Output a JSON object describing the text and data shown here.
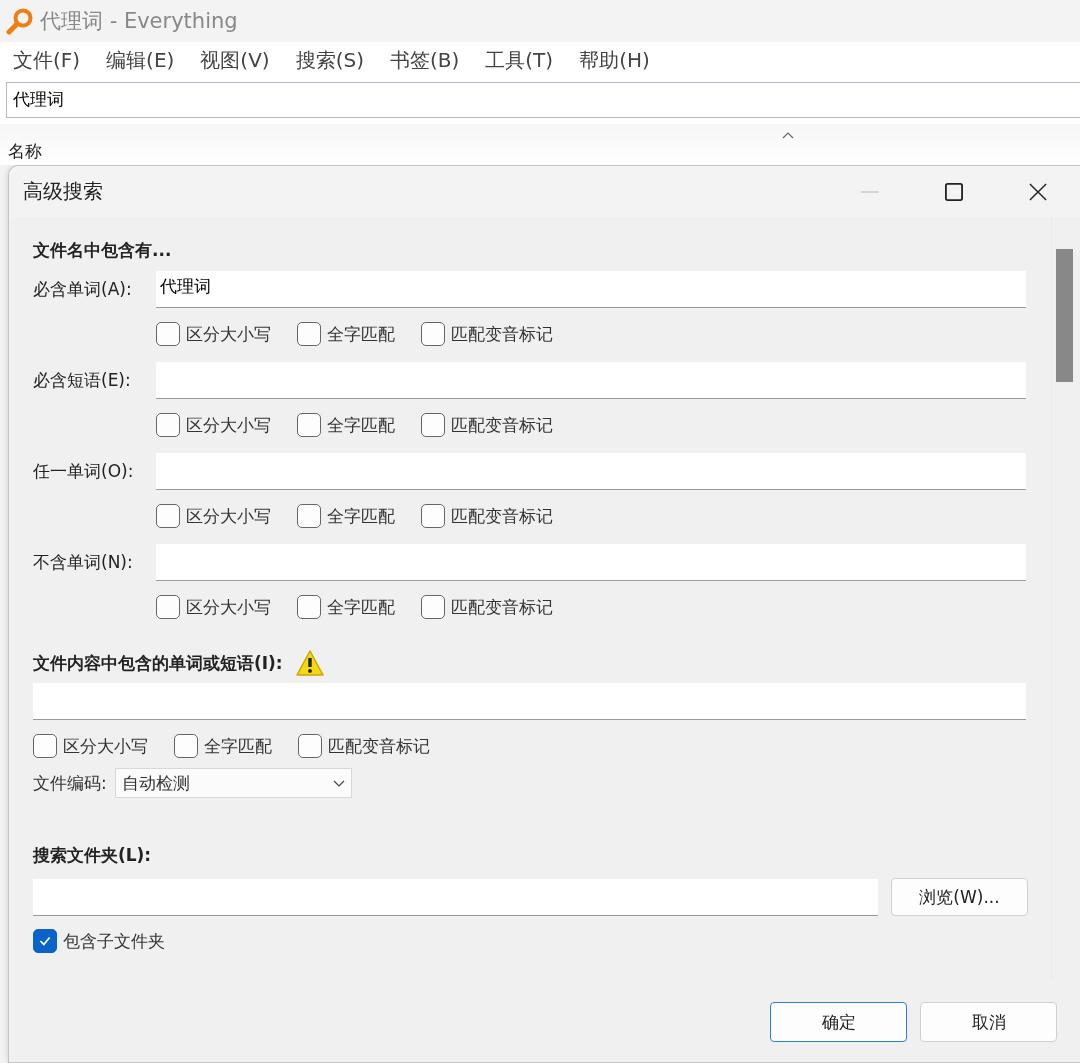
{
  "window": {
    "title": "代理词 - Everything"
  },
  "menu": [
    "文件(F)",
    "编辑(E)",
    "视图(V)",
    "搜索(S)",
    "书签(B)",
    "工具(T)",
    "帮助(H)"
  ],
  "search": {
    "value": "代理词"
  },
  "columns": [
    {
      "label": "名称"
    }
  ],
  "dialog": {
    "title": "高级搜索",
    "minimize_disabled": true,
    "name_section": {
      "heading": "文件名中包含有...",
      "rows": [
        {
          "label": "必含单词(A):",
          "value": "代理词",
          "options": [
            {
              "label": "区分大小写",
              "checked": false
            },
            {
              "label": "全字匹配",
              "checked": false
            },
            {
              "label": "匹配变音标记",
              "checked": false
            }
          ]
        },
        {
          "label": "必含短语(E):",
          "options": [
            {
              "label": "区分大小写",
              "checked": false
            },
            {
              "label": "全字匹配",
              "checked": false
            },
            {
              "label": "匹配变音标记",
              "checked": false
            }
          ]
        },
        {
          "label": "任一单词(O):",
          "options": [
            {
              "label": "区分大小写",
              "checked": false
            },
            {
              "label": "全字匹配",
              "checked": false
            },
            {
              "label": "匹配变音标记",
              "checked": false
            }
          ]
        },
        {
          "label": "不含单词(N):",
          "options": [
            {
              "label": "区分大小写",
              "checked": false
            },
            {
              "label": "全字匹配",
              "checked": false
            },
            {
              "label": "匹配变音标记",
              "checked": false
            }
          ]
        }
      ]
    },
    "content_section": {
      "heading": "文件内容中包含的单词或短语(I):",
      "warning": true,
      "options": [
        {
          "label": "区分大小写",
          "checked": false
        },
        {
          "label": "全字匹配",
          "checked": false
        },
        {
          "label": "匹配变音标记",
          "checked": false
        }
      ],
      "encoding_label": "文件编码:",
      "encoding_value": "自动检测"
    },
    "folder_section": {
      "heading": "搜索文件夹(L):",
      "browse": "浏览(W)...",
      "subfolders": {
        "label": "包含子文件夹",
        "checked": true
      }
    },
    "buttons": [
      {
        "label": "确定",
        "default": true
      },
      {
        "label": "取消",
        "default": false
      }
    ]
  }
}
